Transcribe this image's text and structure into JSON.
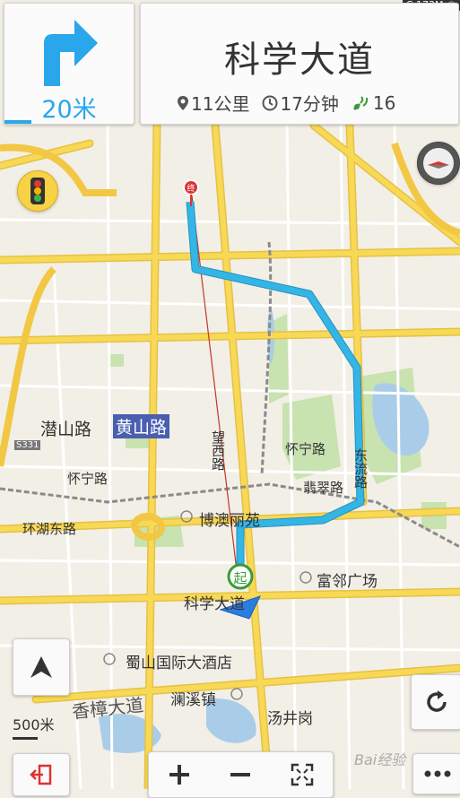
{
  "status": {
    "text": "C 173M ©"
  },
  "turn": {
    "distance": "20米"
  },
  "road": {
    "name": "科学大道"
  },
  "stats": {
    "distance": "11公里",
    "time": "17分钟",
    "signal": "16"
  },
  "places": {
    "qianshan": "潜山路",
    "huangshan": "黄山路",
    "huaining": "怀宁路",
    "huaining2": "怀宁路",
    "huanhu": "环湖东路",
    "feicui": "翡翠路",
    "boao": "博澳丽苑",
    "fulin": "富邻广场",
    "kexue": "科学大道",
    "shushan": "蜀山国际大酒店",
    "xiangzhang": "香樟大道",
    "lanxi": "澜溪镇",
    "tangjing": "汤井岗",
    "wangxi": "望西路",
    "dongliu": "东流路",
    "s331": "S331",
    "start": "起",
    "end": "终"
  },
  "scale": {
    "label": "500米"
  },
  "watermark": {
    "text": "Bai经验"
  },
  "colors": {
    "route": "#33b6e6",
    "accent": "#2aa7ea",
    "road_major": "#f7d956",
    "road_edge": "#e6c145",
    "park": "#c8e2b0",
    "water": "#a9cde8"
  }
}
